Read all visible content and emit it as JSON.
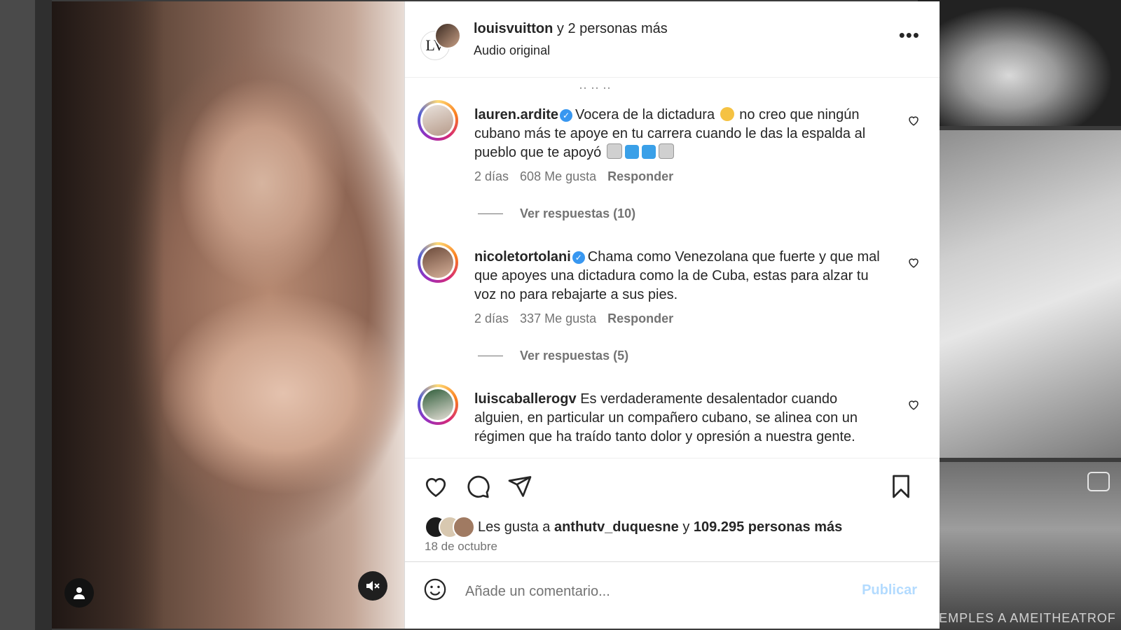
{
  "post": {
    "author_primary": "louisvuitton",
    "author_rest": " y 2 personas más",
    "audio": "Audio original",
    "more_label": "•••"
  },
  "comments": [
    {
      "user": "lauren.ardite",
      "verified": true,
      "text_a": "Vocera de la dictadura ",
      "text_b": " no creo que ningún cubano más te apoye en tu carrera cuando le das la espalda al pueblo que te apoyó ",
      "time": "2 días",
      "likes": "608 Me gusta",
      "reply": "Responder",
      "replies": "Ver respuestas (10)"
    },
    {
      "user": "nicoletortolani",
      "verified": true,
      "text": "Chama como Venezolana que fuerte y que mal que apoyes una dictadura como la de Cuba, estas para alzar tu voz no para rebajarte a sus pies.",
      "time": "2 días",
      "likes": "337 Me gusta",
      "reply": "Responder",
      "replies": "Ver respuestas (5)"
    },
    {
      "user": "luiscaballerogv",
      "verified": false,
      "text": "Es verdaderamente desalentador cuando alguien, en particular un compañero cubano, se alinea con un régimen que ha traído tanto dolor y opresión a nuestra gente."
    }
  ],
  "likes": {
    "prefix": "Les gusta a ",
    "user": "anthutv_duquesne",
    "middle": " y ",
    "count": "109.295 personas más",
    "date": "18 de octubre"
  },
  "add_comment": {
    "placeholder": "Añade un comentario...",
    "publish": "Publicar"
  },
  "background": {
    "tile_caption": "EJEMPLES A AMEITHEATROF"
  },
  "colors": {
    "accent": "#3897f0",
    "publish_disabled": "#b3dbff"
  }
}
